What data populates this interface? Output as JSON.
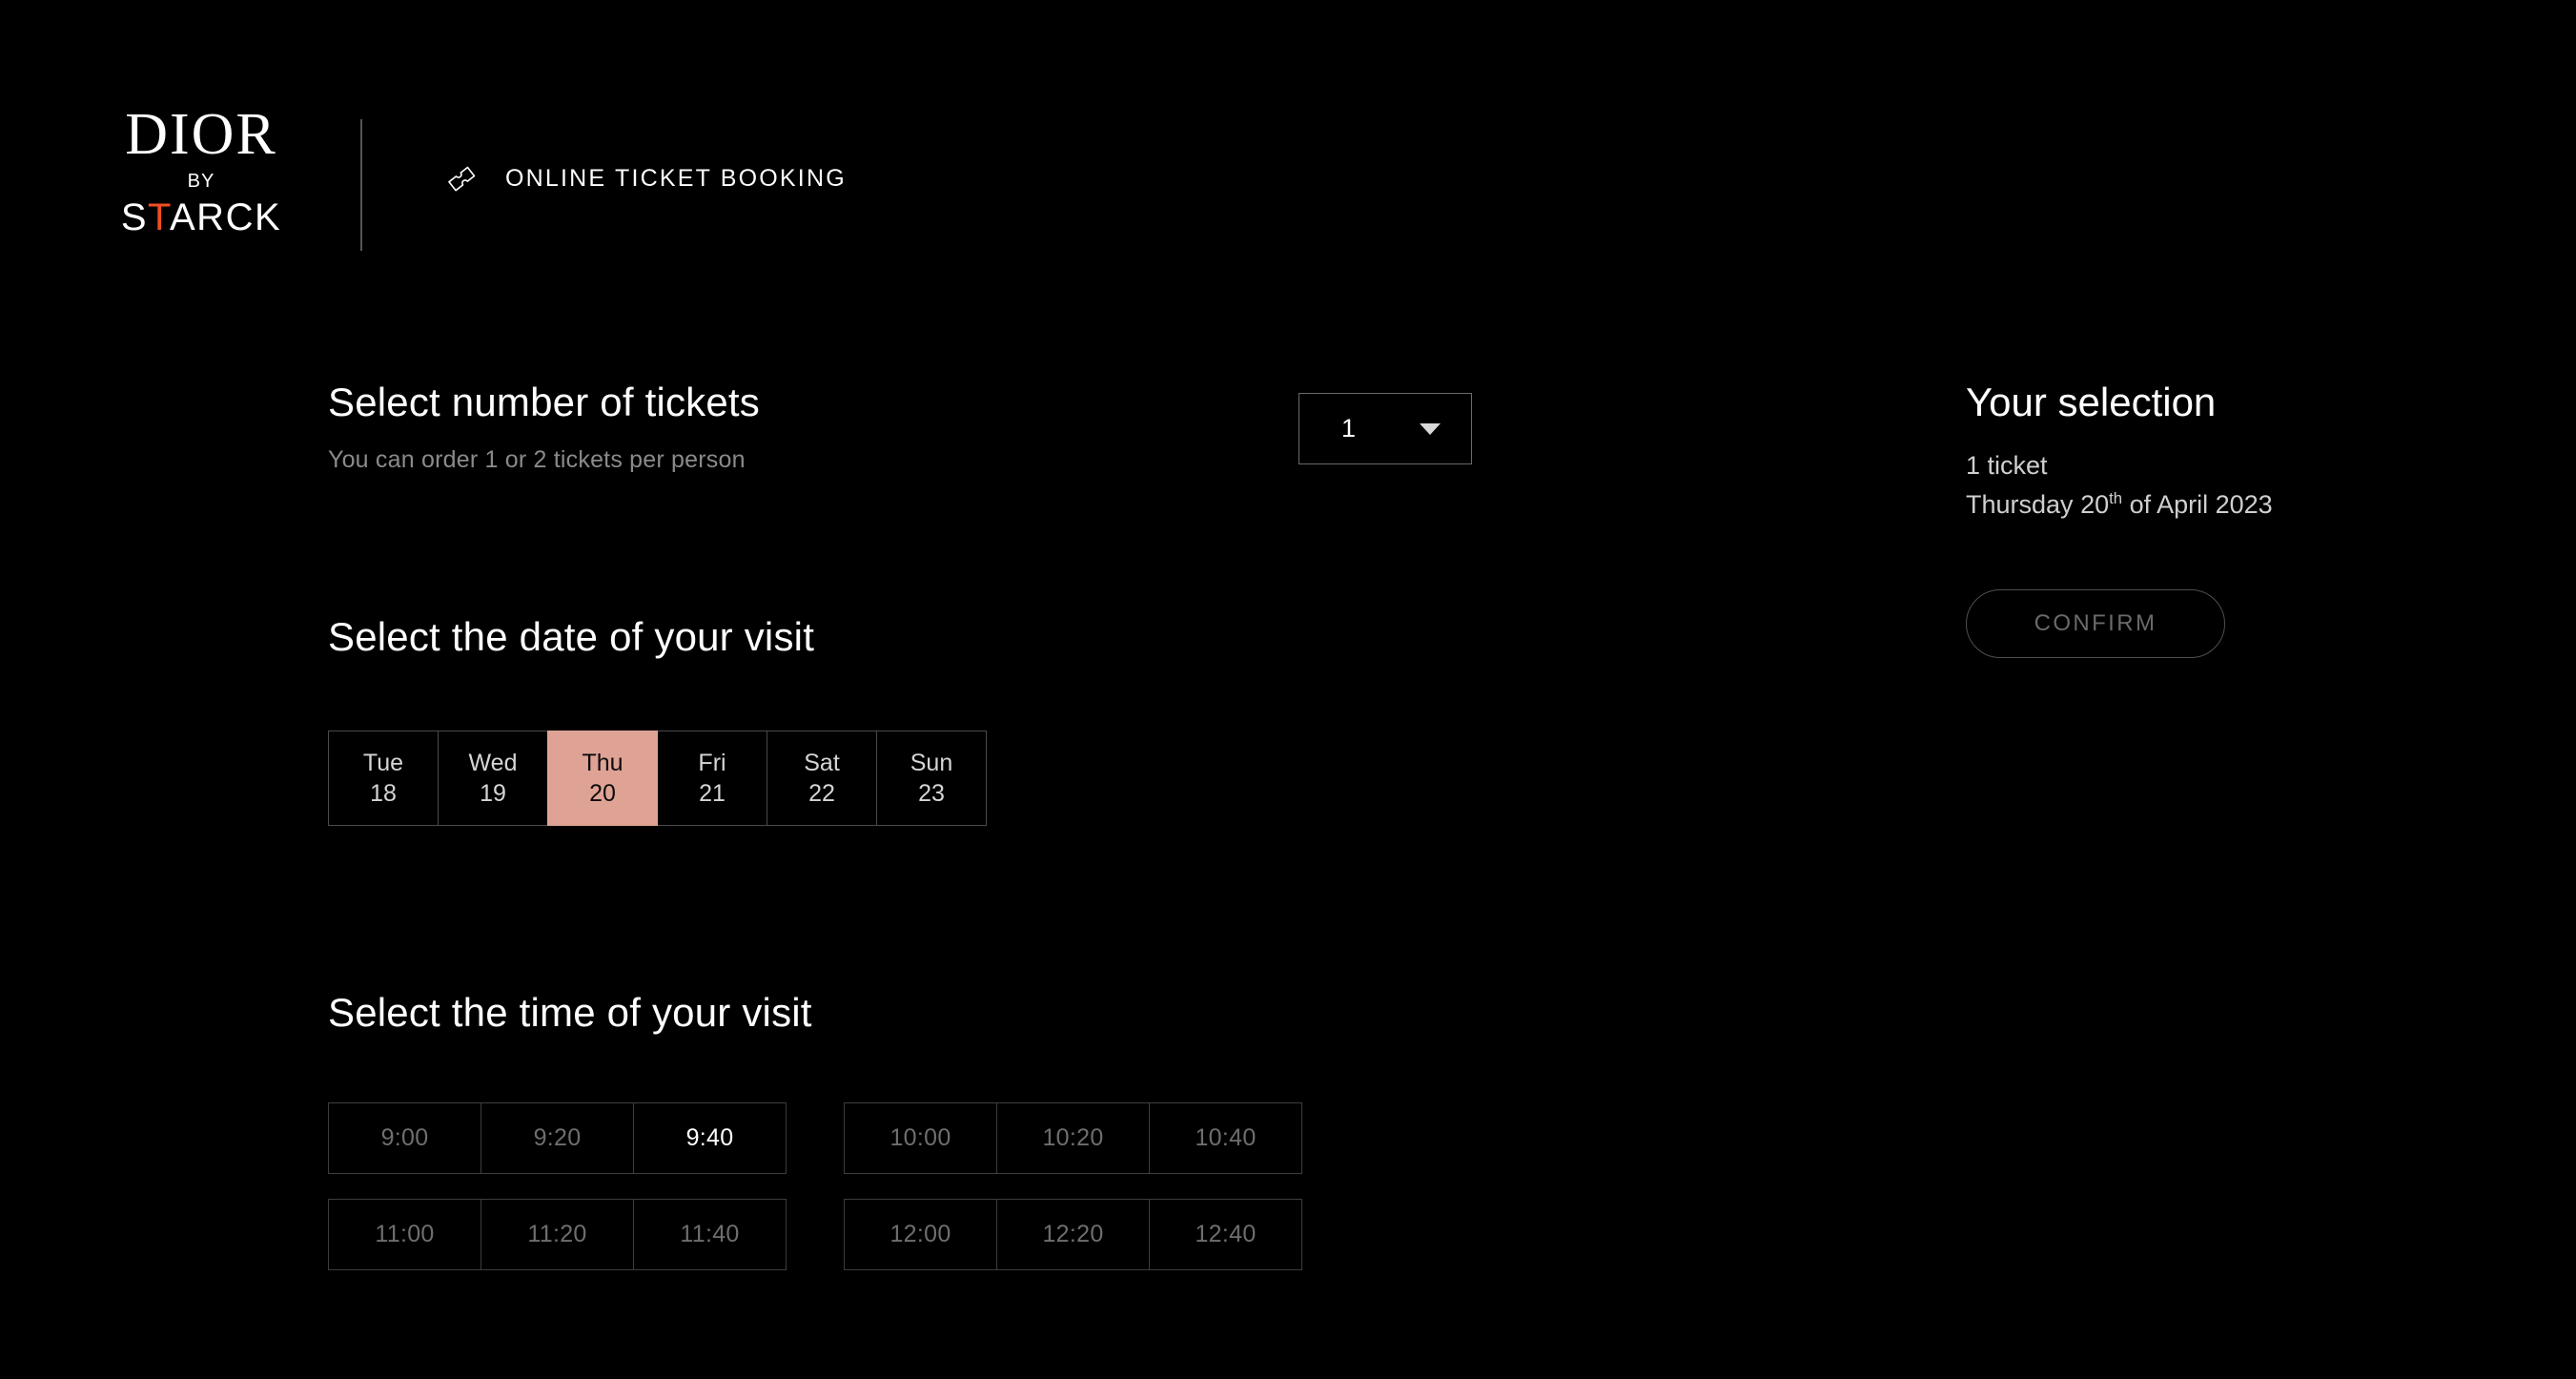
{
  "brand": {
    "name": "DIOR",
    "by": "BY",
    "designer_prefix": "S",
    "designer_accent": "T",
    "designer_suffix": "ARCK",
    "accent_color": "#F04E23"
  },
  "header": {
    "booking_label": "ONLINE TICKET BOOKING",
    "ticket_icon": "ticket-icon"
  },
  "tickets": {
    "title": "Select number of tickets",
    "subtitle": "You can order 1 or 2 tickets per person",
    "quantity_value": "1",
    "chevron_icon": "chevron-down-icon"
  },
  "date": {
    "title": "Select the date of your visit",
    "selected_index": 2,
    "cells": [
      {
        "dow": "Tue",
        "num": "18",
        "selected": false
      },
      {
        "dow": "Wed",
        "num": "19",
        "selected": false
      },
      {
        "dow": "Thu",
        "num": "20",
        "selected": true
      },
      {
        "dow": "Fri",
        "num": "21",
        "selected": false
      },
      {
        "dow": "Sat",
        "num": "22",
        "selected": false
      },
      {
        "dow": "Sun",
        "num": "23",
        "selected": false
      }
    ],
    "selected_color": "#DFA396"
  },
  "time": {
    "title": "Select the time of your visit",
    "rows": [
      {
        "groups": [
          {
            "slots": [
              {
                "label": "9:00",
                "available": false
              },
              {
                "label": "9:20",
                "available": false
              },
              {
                "label": "9:40",
                "available": true
              }
            ]
          },
          {
            "slots": [
              {
                "label": "10:00",
                "available": false
              },
              {
                "label": "10:20",
                "available": false
              },
              {
                "label": "10:40",
                "available": false
              }
            ]
          }
        ]
      },
      {
        "groups": [
          {
            "slots": [
              {
                "label": "11:00",
                "available": false
              },
              {
                "label": "11:20",
                "available": false
              },
              {
                "label": "11:40",
                "available": false
              }
            ]
          },
          {
            "slots": [
              {
                "label": "12:00",
                "available": false
              },
              {
                "label": "12:20",
                "available": false
              },
              {
                "label": "12:40",
                "available": false
              }
            ]
          }
        ]
      }
    ]
  },
  "sidebar": {
    "title": "Your selection",
    "ticket_summary": "1 ticket",
    "date_weekday": "Thursday ",
    "date_day": "20",
    "date_ordinal": "th",
    "date_rest": " of April 2023",
    "confirm_label": "CONFIRM"
  }
}
